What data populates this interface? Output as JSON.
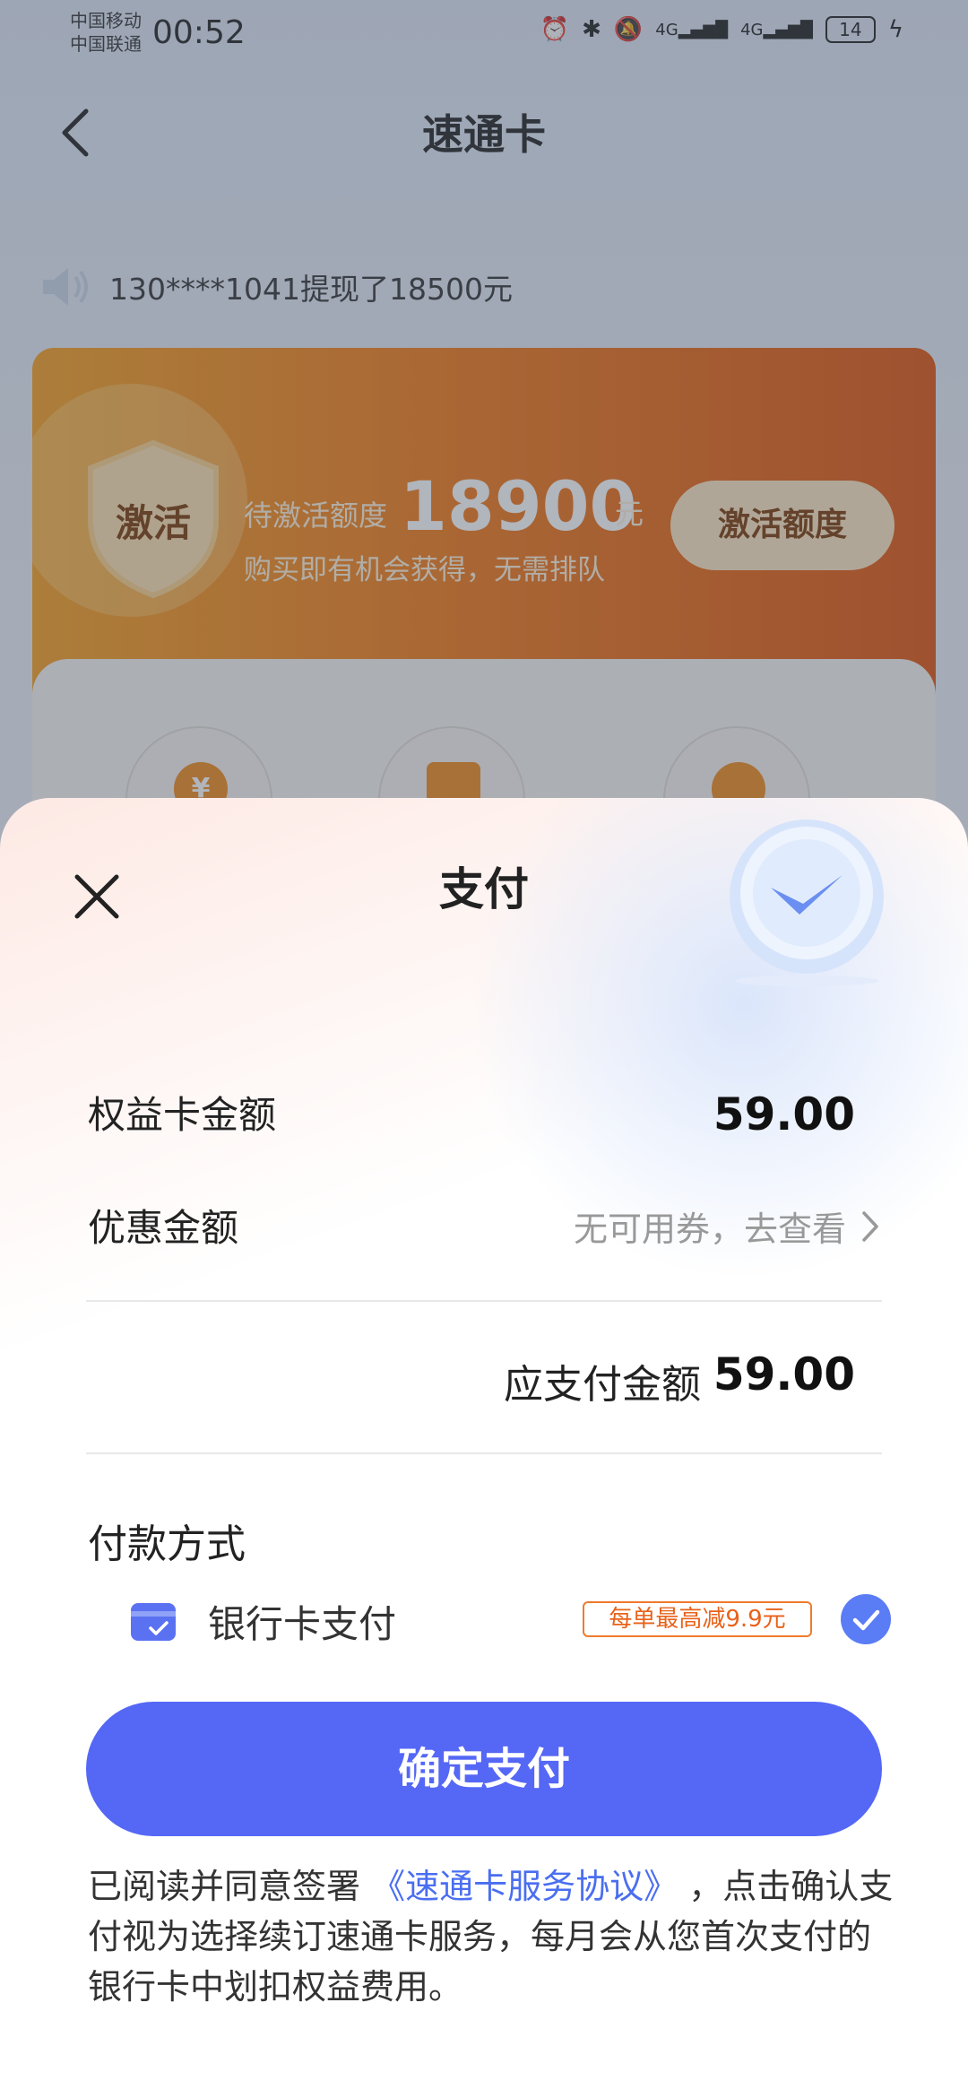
{
  "status": {
    "carrier1": "中国移动",
    "carrier2": "中国联通",
    "time": "00:52",
    "network1": "4G",
    "network2": "4G",
    "battery": "14"
  },
  "nav": {
    "title": "速通卡"
  },
  "notice": {
    "text": "130****1041提现了18500元"
  },
  "activate": {
    "shield_text": "激活",
    "pending_label": "待激活额度",
    "amount": "18900",
    "unit": "元",
    "subtitle": "购买即有机会获得，无需排队",
    "button": "激活额度"
  },
  "features": {
    "icon1": "¥"
  },
  "sheet": {
    "title": "支付",
    "card_amount_label": "权益卡金额",
    "card_amount_value": "59.00",
    "discount_label": "优惠金额",
    "discount_value": "无可用券，去查看",
    "payable_label": "应支付金额",
    "payable_value": "59.00",
    "method_title": "付款方式",
    "method_label": "银行卡支付",
    "promo": "每单最高减9.9元",
    "confirm_button": "确定支付",
    "agreement_prefix": "已阅读并同意签署",
    "agreement_link": "《速通卡服务协议》",
    "agreement_suffix": "，点击确认支付视为选择续订速通卡服务，每月会从您首次支付的银行卡中划扣权益费用。"
  },
  "colors": {
    "primary": "#5567f5",
    "orange": "#f37a16",
    "promo": "#f07a2e"
  }
}
